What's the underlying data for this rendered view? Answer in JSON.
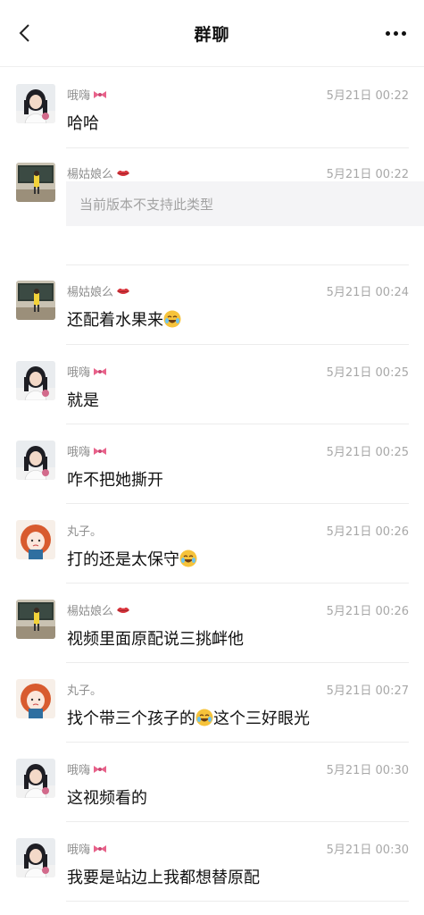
{
  "header": {
    "title": "群聊",
    "back_icon": "chevron-left-icon",
    "more_icon": "more-dots-icon"
  },
  "messages": [
    {
      "sender": "哦嗨",
      "badge": "bow",
      "time": "5月21日 00:22",
      "text": "哈哈",
      "avatar": "girl"
    },
    {
      "sender": "楊姑娘么",
      "badge": "lips",
      "time": "5月21日 00:22",
      "unsupported": "当前版本不支持此类型",
      "avatar": "classroom"
    },
    {
      "sender": "楊姑娘么",
      "badge": "lips",
      "time": "5月21日 00:24",
      "text": "还配着水果来",
      "emoji": "laugh-cry",
      "avatar": "classroom"
    },
    {
      "sender": "哦嗨",
      "badge": "bow",
      "time": "5月21日 00:25",
      "text": "就是",
      "avatar": "girl"
    },
    {
      "sender": "哦嗨",
      "badge": "bow",
      "time": "5月21日 00:25",
      "text": "咋不把她撕开",
      "avatar": "girl"
    },
    {
      "sender": "丸子。",
      "badge": "",
      "time": "5月21日 00:26",
      "text": "打的还是太保守",
      "emoji": "joy",
      "avatar": "redhair"
    },
    {
      "sender": "楊姑娘么",
      "badge": "lips",
      "time": "5月21日 00:26",
      "text": "视频里面原配说三挑衅他",
      "avatar": "classroom"
    },
    {
      "sender": "丸子。",
      "badge": "",
      "time": "5月21日 00:27",
      "text_a": "找个带三个孩子的",
      "text_b": "这个三好眼光",
      "emoji": "joy",
      "avatar": "redhair"
    },
    {
      "sender": "哦嗨",
      "badge": "bow",
      "time": "5月21日 00:30",
      "text": "这视频看的",
      "avatar": "girl"
    },
    {
      "sender": "哦嗨",
      "badge": "bow",
      "time": "5月21日 00:30",
      "text": "我要是站边上我都想替原配",
      "avatar": "girl"
    }
  ],
  "colors": {
    "name": "#8f8f8f",
    "time": "#a8a8a8",
    "bow": "#e8628a",
    "lips": "#d9363e",
    "bubble": "#f4f4f6"
  }
}
